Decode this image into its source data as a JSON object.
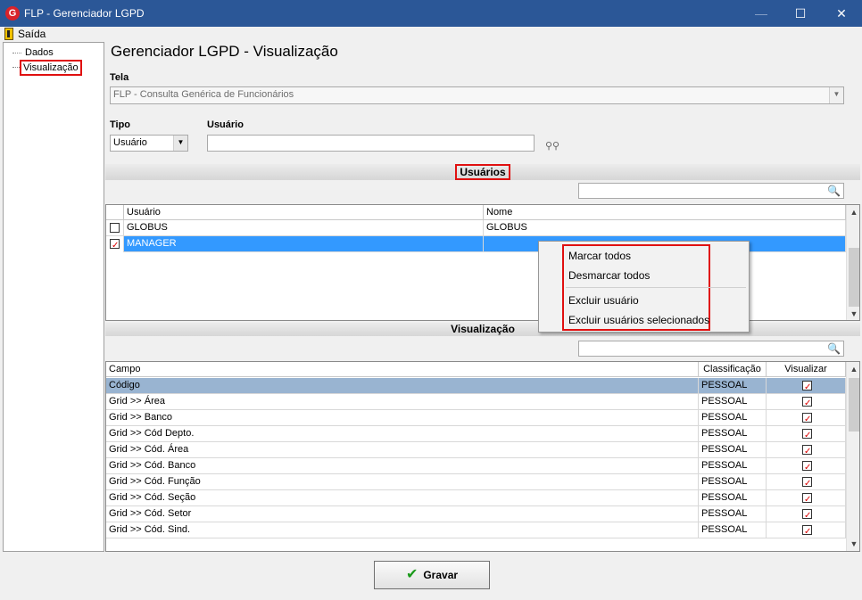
{
  "window": {
    "title": "FLP - Gerenciador LGPD",
    "app_icon": "G",
    "minimize": "—",
    "maximize": "☐",
    "close": "✕"
  },
  "menu": {
    "exit_label": "Saída"
  },
  "tree": {
    "items": [
      {
        "label": "Dados"
      },
      {
        "label": "Visualização",
        "selected": true
      }
    ]
  },
  "page_title": "Gerenciador LGPD - Visualização",
  "tela": {
    "label": "Tela",
    "value": "FLP - Consulta Genérica de Funcionários"
  },
  "tipo": {
    "label": "Tipo",
    "value": "Usuário"
  },
  "usuario": {
    "label": "Usuário",
    "value": ""
  },
  "usuarios_section": {
    "title": "Usuários",
    "search_value": "",
    "columns": [
      "Usuário",
      "Nome"
    ],
    "rows": [
      {
        "checked": false,
        "usuario": "GLOBUS",
        "nome": "GLOBUS"
      },
      {
        "checked": true,
        "usuario": "MANAGER",
        "nome": "",
        "selected": true
      }
    ]
  },
  "context_menu": {
    "items": [
      "Marcar todos",
      "Desmarcar todos",
      "Excluir usuário",
      "Excluir usuários selecionados"
    ]
  },
  "visualizacao_section": {
    "title": "Visualização",
    "search_value": "",
    "columns": [
      "Campo",
      "Classificação",
      "Visualizar"
    ],
    "rows": [
      {
        "campo": "Código",
        "classificacao": "PESSOAL",
        "visualizar": true,
        "selected": true
      },
      {
        "campo": "Grid >> Área",
        "classificacao": "PESSOAL",
        "visualizar": true
      },
      {
        "campo": "Grid >> Banco",
        "classificacao": "PESSOAL",
        "visualizar": true
      },
      {
        "campo": "Grid >> Cód Depto.",
        "classificacao": "PESSOAL",
        "visualizar": true
      },
      {
        "campo": "Grid >> Cód. Área",
        "classificacao": "PESSOAL",
        "visualizar": true
      },
      {
        "campo": "Grid >> Cód. Banco",
        "classificacao": "PESSOAL",
        "visualizar": true
      },
      {
        "campo": "Grid >> Cód. Função",
        "classificacao": "PESSOAL",
        "visualizar": true
      },
      {
        "campo": "Grid >> Cód. Seção",
        "classificacao": "PESSOAL",
        "visualizar": true
      },
      {
        "campo": "Grid >> Cód. Setor",
        "classificacao": "PESSOAL",
        "visualizar": true
      },
      {
        "campo": "Grid >> Cód. Sind.",
        "classificacao": "PESSOAL",
        "visualizar": true
      }
    ]
  },
  "gravar_button": {
    "label": "Gravar",
    "icon": "checkmark-icon"
  },
  "colors": {
    "titlebar": "#2b5797",
    "highlight_border": "#e01010",
    "selected_row": "#3399ff",
    "selected_row_light": "#99b4d1"
  }
}
